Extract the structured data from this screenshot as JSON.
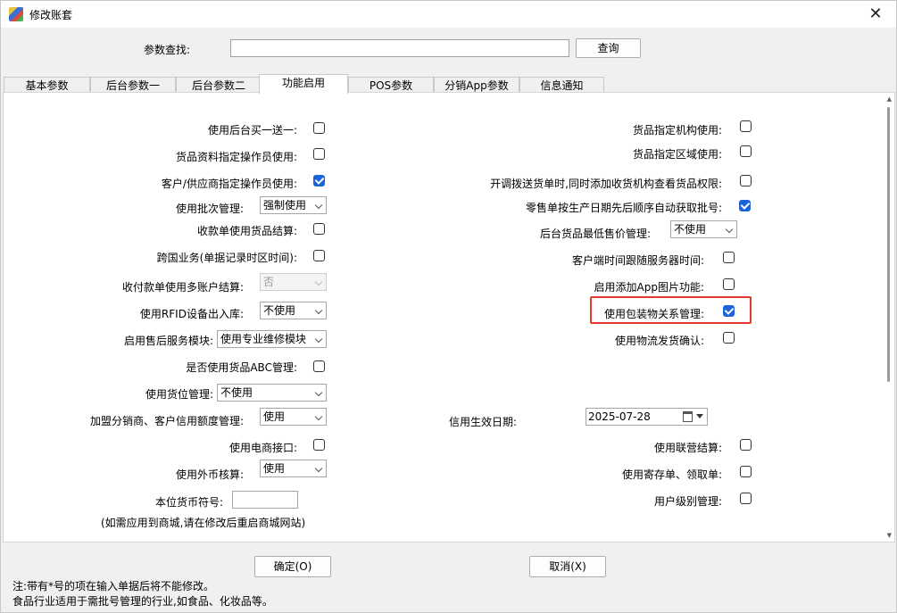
{
  "window": {
    "title": "修改账套",
    "close": "✕"
  },
  "search": {
    "label": "参数查找:",
    "button": "查询",
    "value": ""
  },
  "tabs": [
    "基本参数",
    "后台参数一",
    "后台参数二",
    "功能启用",
    "POS参数",
    "分销App参数",
    "信息通知"
  ],
  "active_tab": "功能启用",
  "left": {
    "buy_one_get_one": {
      "label": "使用后台买一送一:",
      "checked": false
    },
    "goods_operator": {
      "label": "货品资料指定操作员使用:",
      "checked": false
    },
    "customer_operator": {
      "label": "客户/供应商指定操作员使用:",
      "checked": true
    },
    "batch_mgmt": {
      "label": "使用批次管理:",
      "value": "强制使用"
    },
    "receipt_settle": {
      "label": "收款单使用货品结算:",
      "checked": false
    },
    "cross_border": {
      "label": "跨国业务(单据记录时区时间):",
      "checked": false
    },
    "multi_account": {
      "label": "收付款单使用多账户结算:",
      "value": "否"
    },
    "rfid": {
      "label": "使用RFID设备出入库:",
      "value": "不使用"
    },
    "after_sales": {
      "label": "启用售后服务模块:",
      "value": "使用专业维修模块"
    },
    "abc": {
      "label": "是否使用货品ABC管理:",
      "checked": false
    },
    "location": {
      "label": "使用货位管理:",
      "value": "不使用"
    },
    "credit_limit": {
      "label": "加盟分销商、客户信用额度管理:",
      "value": "使用"
    },
    "ecommerce": {
      "label": "使用电商接口:",
      "checked": false
    },
    "foreign_currency": {
      "label": "使用外币核算:",
      "value": "使用"
    },
    "currency_symbol": {
      "label": "本位货币符号:",
      "value": ""
    },
    "currency_note": "(如需应用到商城,请在修改后重启商城网站)"
  },
  "right": {
    "goods_org": {
      "label": "货品指定机构使用:",
      "checked": false
    },
    "goods_region": {
      "label": "货品指定区域使用:",
      "checked": false
    },
    "transfer_permission": {
      "label": "开调拨送货单时,同时添加收货机构查看货品权限:",
      "checked": false
    },
    "retail_batch": {
      "label": "零售单按生产日期先后顺序自动获取批号:",
      "checked": true
    },
    "min_price": {
      "label": "后台货品最低售价管理:",
      "value": "不使用"
    },
    "client_time": {
      "label": "客户端时间跟随服务器时间:",
      "checked": false
    },
    "app_images": {
      "label": "启用添加App图片功能:",
      "checked": false
    },
    "packaging": {
      "label": "使用包装物关系管理:",
      "checked": true
    },
    "logistics": {
      "label": "使用物流发货确认:",
      "checked": false
    },
    "credit_date": {
      "label": "信用生效日期:",
      "value": "2025-07-28"
    },
    "joint_settle": {
      "label": "使用联营结算:",
      "checked": false
    },
    "deposit": {
      "label": "使用寄存单、领取单:",
      "checked": false
    },
    "user_level": {
      "label": "用户级别管理:",
      "checked": false
    }
  },
  "footer": {
    "ok": "确定(O)",
    "cancel": "取消(X)",
    "note1": "注:带有*号的项在输入单据后将不能修改。",
    "note2": "食品行业适用于需批号管理的行业,如食品、化妆品等。"
  },
  "colors": {
    "accent": "#1a63d8",
    "highlight": "#e0392f"
  }
}
